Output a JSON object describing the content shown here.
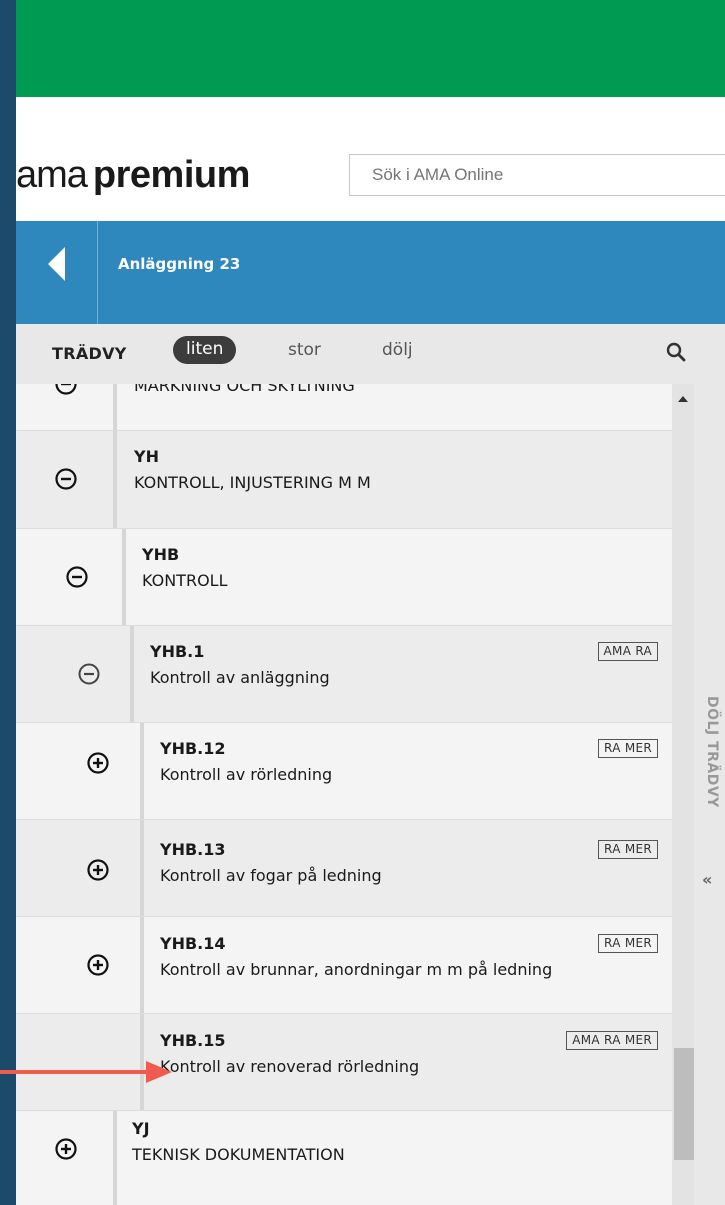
{
  "header": {
    "logo_light": "ama",
    "logo_bold": "premium",
    "search_placeholder": "Sök i AMA Online"
  },
  "nav": {
    "breadcrumb": "Anläggning 23"
  },
  "treeview": {
    "title": "TRÄDVY",
    "options": [
      "liten",
      "stor",
      "dölj"
    ],
    "active_option": "liten",
    "hide_label": "DÖLJ TRÄDVY",
    "hide_chevron": "«"
  },
  "tree": {
    "partial_top_title": "MARKNING OCH SKYLTNING",
    "items": [
      {
        "code": "YH",
        "title": "KONTROLL, INJUSTERING M M",
        "badge": "",
        "expand_state": "minus"
      },
      {
        "code": "YHB",
        "title": "KONTROLL",
        "badge": "",
        "expand_state": "minus"
      },
      {
        "code": "YHB.1",
        "title": "Kontroll av anläggning",
        "badge": "AMA RA",
        "expand_state": "minus"
      },
      {
        "code": "YHB.12",
        "title": "Kontroll av rörledning",
        "badge": "RA MER",
        "expand_state": "plus"
      },
      {
        "code": "YHB.13",
        "title": "Kontroll av fogar på ledning",
        "badge": "RA MER",
        "expand_state": "plus"
      },
      {
        "code": "YHB.14",
        "title": "Kontroll av brunnar, anordningar m m på ledning",
        "badge": "RA MER",
        "expand_state": "plus"
      },
      {
        "code": "YHB.15",
        "title": "Kontroll av renoverad rörledning",
        "badge": "AMA RA MER",
        "expand_state": "none"
      },
      {
        "code": "YJ",
        "title": "TEKNISK DOKUMENTATION",
        "badge": "",
        "expand_state": "plus"
      }
    ]
  },
  "colors": {
    "green": "#009a53",
    "blue": "#2e88bd",
    "frame": "#1b4a6b",
    "annotation_arrow": "#f15a4c"
  }
}
